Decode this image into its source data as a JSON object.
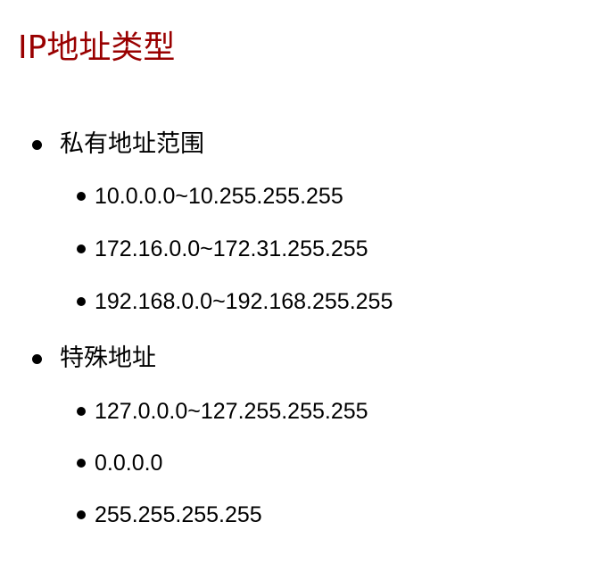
{
  "title": "IP地址类型",
  "sections": [
    {
      "heading": "私有地址范围",
      "items": [
        "10.0.0.0~10.255.255.255",
        "172.16.0.0~172.31.255.255",
        "192.168.0.0~192.168.255.255"
      ]
    },
    {
      "heading": "特殊地址",
      "items": [
        "127.0.0.0~127.255.255.255",
        "0.0.0.0",
        "255.255.255.255"
      ]
    }
  ],
  "colors": {
    "title": "#990000",
    "text": "#000000",
    "background": "#ffffff"
  }
}
